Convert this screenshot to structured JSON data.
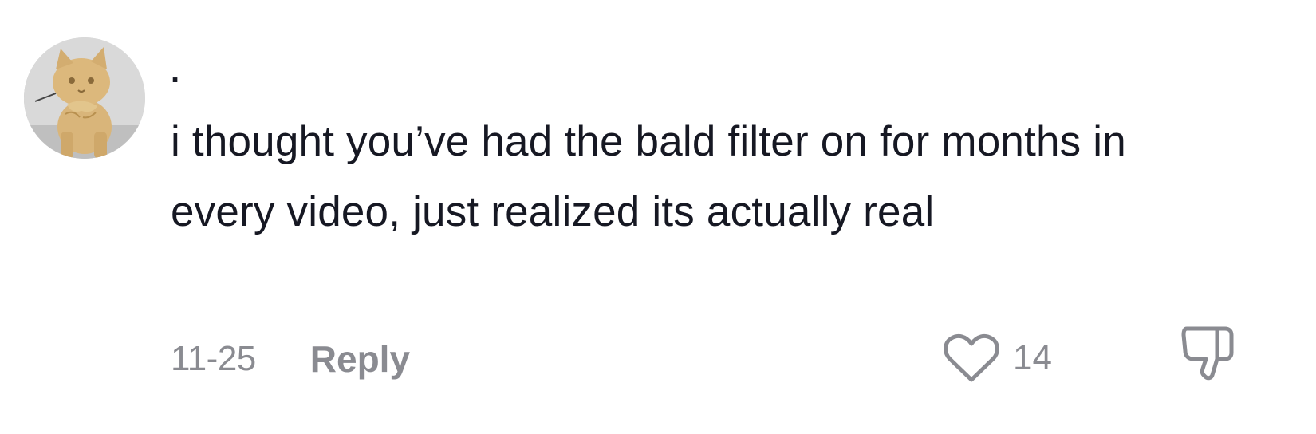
{
  "comment": {
    "username": ".",
    "text": "i thought you’ve had the bald filter on for months in every video, just realized its actually real",
    "timestamp": "11-25",
    "reply_label": "Reply",
    "like_count": "14"
  },
  "icons": {
    "like": "heart-icon",
    "dislike": "thumbs-down-icon",
    "avatar": "cat-avatar"
  },
  "colors": {
    "text_primary": "#161823",
    "text_secondary": "#8a8b91",
    "icon_stroke": "#8a8b91"
  }
}
